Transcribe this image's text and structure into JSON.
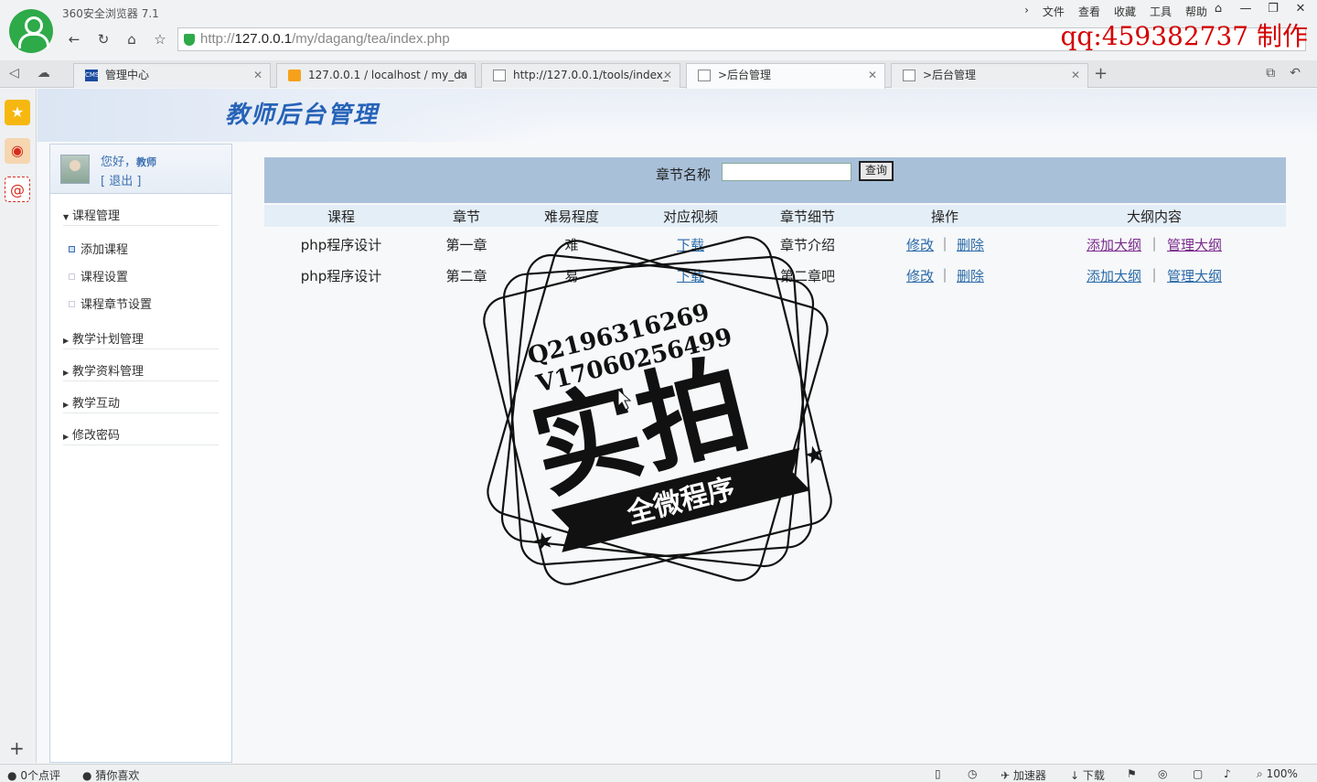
{
  "browser": {
    "title": "360安全浏览器 7.1",
    "menu": [
      "文件",
      "查看",
      "收藏",
      "工具",
      "帮助"
    ],
    "window_controls": [
      "⌂",
      "—",
      "❐",
      "✕"
    ],
    "watermark": "qq:459382737 制作",
    "url_prefix": "http://",
    "url_host": "127.0.0.1",
    "url_path": "/my/dagang/tea/index.php",
    "tabs": [
      {
        "label": "管理中心",
        "icon": "cms-favicon"
      },
      {
        "label": "127.0.0.1 / localhost / my_da",
        "icon": "phpmyadmin-favicon"
      },
      {
        "label": "http://127.0.0.1/tools/index_",
        "icon": "doc-icon"
      },
      {
        "label": ">后台管理",
        "icon": "doc-icon"
      },
      {
        "label": ">后台管理",
        "icon": "doc-icon"
      }
    ],
    "active_tab": 3
  },
  "page": {
    "header_title": "教师后台管理",
    "user": {
      "greeting": "您好，",
      "name": "教师",
      "logout": "[ 退出 ]"
    },
    "menu": {
      "course_mgmt": "课程管理",
      "items": [
        "添加课程",
        "课程设置",
        "课程章节设置"
      ],
      "plan_mgmt": "教学计划管理",
      "material_mgmt": "教学资料管理",
      "interaction": "教学互动",
      "password": "修改密码"
    },
    "search": {
      "label": "章节名称",
      "value": "",
      "button": "查询"
    },
    "table": {
      "headers": [
        "课程",
        "章节",
        "难易程度",
        "对应视频",
        "章节细节",
        "操作",
        "大纲内容"
      ],
      "rows": [
        {
          "course": "php程序设计",
          "chapter": "第一章",
          "difficulty": "难",
          "video": "下载",
          "detail": "章节介绍",
          "edit": "修改",
          "delete": "删除",
          "add_outline": "添加大纲",
          "manage_outline": "管理大纲"
        },
        {
          "course": "php程序设计",
          "chapter": "第二章",
          "difficulty": "易",
          "video": "下载",
          "detail": "第二章吧",
          "edit": "修改",
          "delete": "删除",
          "add_outline": "添加大纲",
          "manage_outline": "管理大纲"
        }
      ],
      "separator": "|"
    }
  },
  "stamp": {
    "line1": "Q2196316269",
    "line2": "V17060256499",
    "big": "实拍",
    "banner": "全微程序"
  },
  "statusbar": {
    "comments": "0个点评",
    "guess": "猜你喜欢",
    "accelerator": "加速器",
    "download": "下载",
    "zoom": "100%"
  }
}
